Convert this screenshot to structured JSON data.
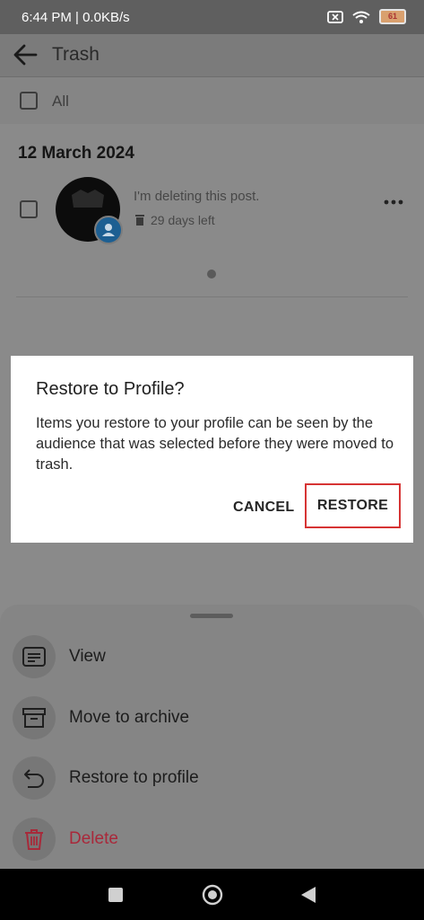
{
  "status_bar": {
    "time": "6:44 PM | 0.0KB/s",
    "battery": "61"
  },
  "app_bar": {
    "title": "Trash"
  },
  "select_all": {
    "label": "All"
  },
  "section": {
    "date": "12 March 2024"
  },
  "post": {
    "text": "I'm deleting this post.",
    "days_left": "29 days left"
  },
  "dialog": {
    "title": "Restore to Profile?",
    "body": "Items you restore to your profile can be seen by the audience that was selected before they were moved to trash.",
    "cancel_label": "CANCEL",
    "restore_label": "RESTORE"
  },
  "sheet": {
    "items": [
      {
        "label": "View",
        "icon": "view-icon"
      },
      {
        "label": "Move to archive",
        "icon": "archive-icon"
      },
      {
        "label": "Restore to profile",
        "icon": "restore-icon"
      },
      {
        "label": "Delete",
        "icon": "trash-icon"
      }
    ]
  },
  "colors": {
    "delete": "#b0283a",
    "highlight": "#d63434"
  }
}
